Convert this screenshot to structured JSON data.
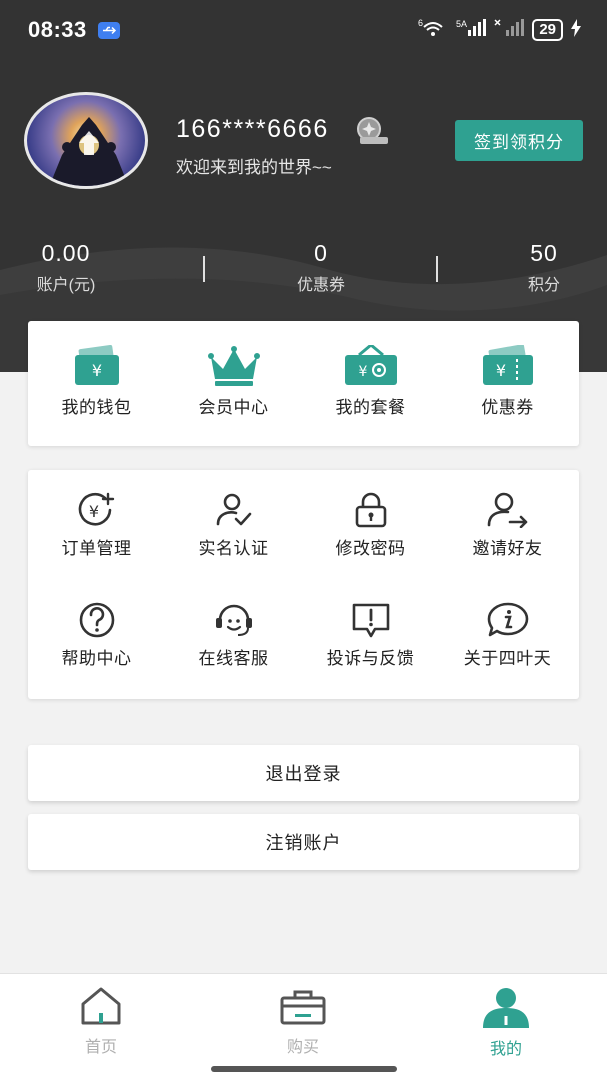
{
  "status_bar": {
    "time": "08:33",
    "network_wifi": "6",
    "network_5g": "5A",
    "battery": "29"
  },
  "profile": {
    "phone": "166****6666",
    "welcome": "欢迎来到我的世界~~",
    "checkin_label": "签到领积分"
  },
  "stats": [
    {
      "value": "0.00",
      "label": "账户(元)"
    },
    {
      "value": "0",
      "label": "优惠券"
    },
    {
      "value": "50",
      "label": "积分"
    }
  ],
  "wallet_menu": [
    {
      "label": "我的钱包",
      "icon": "wallet-icon"
    },
    {
      "label": "会员中心",
      "icon": "crown-icon"
    },
    {
      "label": "我的套餐",
      "icon": "package-icon"
    },
    {
      "label": "优惠券",
      "icon": "coupon-icon"
    }
  ],
  "service_menu": [
    {
      "label": "订单管理",
      "icon": "order-icon"
    },
    {
      "label": "实名认证",
      "icon": "verify-user-icon"
    },
    {
      "label": "修改密码",
      "icon": "lock-icon"
    },
    {
      "label": "邀请好友",
      "icon": "invite-user-icon"
    },
    {
      "label": "帮助中心",
      "icon": "help-icon"
    },
    {
      "label": "在线客服",
      "icon": "customer-service-icon"
    },
    {
      "label": "投诉与反馈",
      "icon": "feedback-icon"
    },
    {
      "label": "关于四叶天",
      "icon": "info-icon"
    }
  ],
  "actions": {
    "logout": "退出登录",
    "cancel_account": "注销账户"
  },
  "tabbar": [
    {
      "label": "首页",
      "icon": "home-icon",
      "active": false
    },
    {
      "label": "购买",
      "icon": "basket-icon",
      "active": false
    },
    {
      "label": "我的",
      "icon": "profile-icon",
      "active": true
    }
  ],
  "colors": {
    "accent": "#2fa191",
    "header_bg": "#333333",
    "page_bg": "#f2f2f2"
  }
}
